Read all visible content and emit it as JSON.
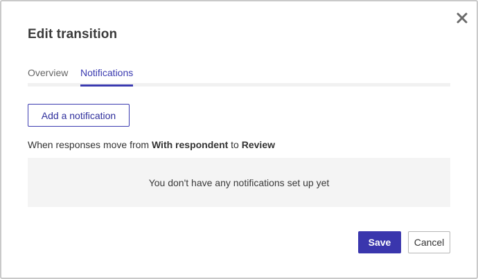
{
  "dialog": {
    "title": "Edit transition",
    "close_icon": "close-icon"
  },
  "tabs": [
    {
      "label": "Overview",
      "active": false
    },
    {
      "label": "Notifications",
      "active": true
    }
  ],
  "colors": {
    "accent": "#3a36ad",
    "tab_active": "#3a3ab0",
    "empty_bg": "#f4f4f4"
  },
  "notifications": {
    "add_button_label": "Add a notification",
    "move_prefix": "When responses move from",
    "from_state": "With respondent",
    "move_connector": "to",
    "to_state": "Review",
    "empty_message": "You don't have any notifications set up yet"
  },
  "footer": {
    "save_label": "Save",
    "cancel_label": "Cancel"
  }
}
